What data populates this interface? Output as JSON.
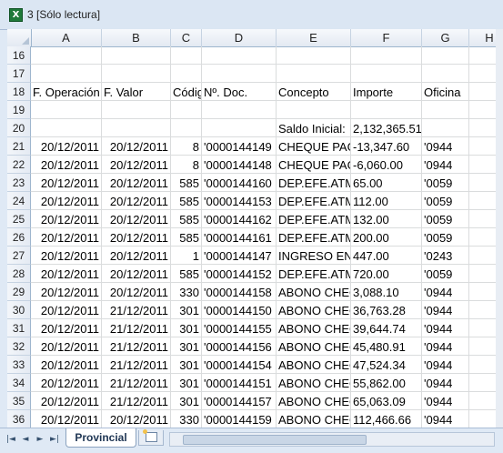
{
  "window": {
    "title": "3  [Sólo lectura]",
    "icon": "excel-icon"
  },
  "columns": [
    "A",
    "B",
    "C",
    "D",
    "E",
    "F",
    "G",
    "H"
  ],
  "rows": [
    {
      "n": "16",
      "cells": [
        "",
        "",
        "",
        "",
        "",
        "",
        ""
      ]
    },
    {
      "n": "17",
      "cells": [
        "",
        "",
        "",
        "",
        "",
        "",
        ""
      ]
    },
    {
      "n": "18",
      "cells": [
        "F. Operación",
        "F. Valor",
        "Código",
        "Nº. Doc.",
        "Concepto",
        "Importe",
        "Oficina"
      ]
    },
    {
      "n": "19",
      "cells": [
        "",
        "",
        "",
        "",
        "",
        "",
        ""
      ]
    },
    {
      "n": "20",
      "cells": [
        "",
        "",
        "",
        "",
        "Saldo Inicial:",
        "2,132,365.51",
        ""
      ]
    },
    {
      "n": "21",
      "cells": [
        "20/12/2011",
        "20/12/2011",
        "8",
        "'0000144149",
        "CHEQUE PAGADO",
        "-13,347.60",
        "'0944"
      ]
    },
    {
      "n": "22",
      "cells": [
        "20/12/2011",
        "20/12/2011",
        "8",
        "'0000144148",
        "CHEQUE PAGADO",
        "-6,060.00",
        "'0944"
      ]
    },
    {
      "n": "23",
      "cells": [
        "20/12/2011",
        "20/12/2011",
        "585",
        "'0000144160",
        "DEP.EFE.ATM",
        "65.00",
        "'0059"
      ]
    },
    {
      "n": "24",
      "cells": [
        "20/12/2011",
        "20/12/2011",
        "585",
        "'0000144153",
        "DEP.EFE.ATM",
        "112.00",
        "'0059"
      ]
    },
    {
      "n": "25",
      "cells": [
        "20/12/2011",
        "20/12/2011",
        "585",
        "'0000144162",
        "DEP.EFE.ATM",
        "132.00",
        "'0059"
      ]
    },
    {
      "n": "26",
      "cells": [
        "20/12/2011",
        "20/12/2011",
        "585",
        "'0000144161",
        "DEP.EFE.ATM",
        "200.00",
        "'0059"
      ]
    },
    {
      "n": "27",
      "cells": [
        "20/12/2011",
        "20/12/2011",
        "1",
        "'0000144147",
        "INGRESO EN",
        "447.00",
        "'0243"
      ]
    },
    {
      "n": "28",
      "cells": [
        "20/12/2011",
        "20/12/2011",
        "585",
        "'0000144152",
        "DEP.EFE.ATM",
        "720.00",
        "'0059"
      ]
    },
    {
      "n": "29",
      "cells": [
        "20/12/2011",
        "20/12/2011",
        "330",
        "'0000144158",
        "ABONO CHEQUE",
        "3,088.10",
        "'0944"
      ]
    },
    {
      "n": "30",
      "cells": [
        "20/12/2011",
        "21/12/2011",
        "301",
        "'0000144150",
        "ABONO CHEQUE",
        "36,763.28",
        "'0944"
      ]
    },
    {
      "n": "31",
      "cells": [
        "20/12/2011",
        "21/12/2011",
        "301",
        "'0000144155",
        "ABONO CHEQUE",
        "39,644.74",
        "'0944"
      ]
    },
    {
      "n": "32",
      "cells": [
        "20/12/2011",
        "21/12/2011",
        "301",
        "'0000144156",
        "ABONO CHEQUE",
        "45,480.91",
        "'0944"
      ]
    },
    {
      "n": "33",
      "cells": [
        "20/12/2011",
        "21/12/2011",
        "301",
        "'0000144154",
        "ABONO CHEQUE",
        "47,524.34",
        "'0944"
      ]
    },
    {
      "n": "34",
      "cells": [
        "20/12/2011",
        "21/12/2011",
        "301",
        "'0000144151",
        "ABONO CHEQUE",
        "55,862.00",
        "'0944"
      ]
    },
    {
      "n": "35",
      "cells": [
        "20/12/2011",
        "21/12/2011",
        "301",
        "'0000144157",
        "ABONO CHEQUE",
        "65,063.09",
        "'0944"
      ]
    },
    {
      "n": "36",
      "cells": [
        "20/12/2011",
        "20/12/2011",
        "330",
        "'0000144159",
        "ABONO CHEQUE",
        "112,466.66",
        "'0944"
      ]
    }
  ],
  "sheet_tab": {
    "label": "Provincial"
  },
  "nav": {
    "first": "|◄",
    "prev": "◄",
    "next": "►",
    "last": "►|"
  }
}
